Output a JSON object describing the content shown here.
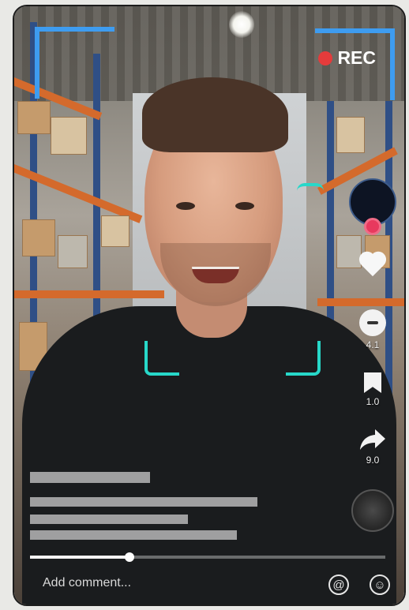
{
  "recording": {
    "label": "REC",
    "dot_color": "#e53b3b"
  },
  "overlay": {
    "frame_color": "#3e9cf0",
    "face_bracket_color": "#27d8c9"
  },
  "actions": {
    "save_count": "1.0",
    "share_count": "9.0",
    "comment_count": "4.1"
  },
  "bottom": {
    "comment_placeholder": "Add comment...",
    "progress_fraction": 0.28
  },
  "icons": [
    "record-dot-icon",
    "heart-icon",
    "comment-icon",
    "bookmark-icon",
    "share-icon",
    "music-disc-icon",
    "at-mention-icon",
    "emoji-icon"
  ]
}
